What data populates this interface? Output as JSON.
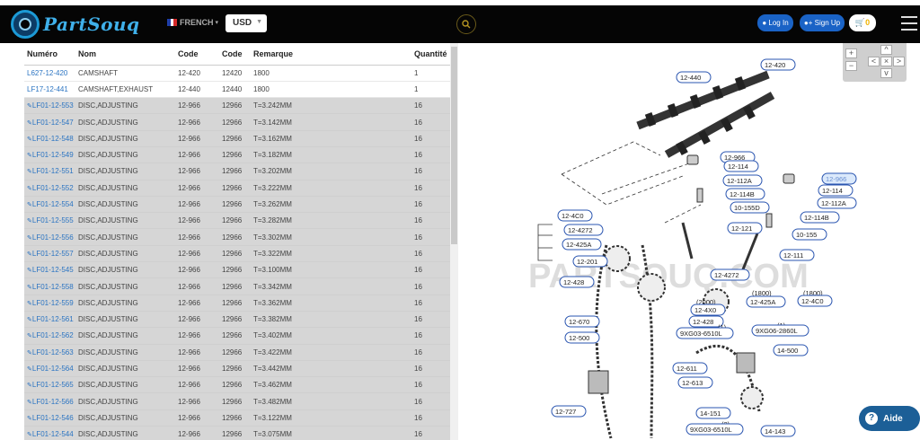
{
  "header": {
    "logo_text": "PartSouq",
    "language": "FRENCH",
    "currency": "USD",
    "login_label": "Log In",
    "signup_label": "Sign Up",
    "cart_count": "0"
  },
  "table": {
    "columns": [
      "Numéro",
      "Nom",
      "Code",
      "Code",
      "Remarque",
      "Quantité"
    ],
    "rows": [
      {
        "num": "L627-12-420",
        "name": "CAMSHAFT",
        "code1": "12-420",
        "code2": "12420",
        "remark": "1800",
        "qty": "1",
        "grey": false
      },
      {
        "num": "LF17-12-441",
        "name": "CAMSHAFT,EXHAUST",
        "code1": "12-440",
        "code2": "12440",
        "remark": "1800",
        "qty": "1",
        "grey": false
      },
      {
        "num": "LF01-12-553",
        "name": "DISC,ADJUSTING",
        "code1": "12-966",
        "code2": "12966",
        "remark": "T=3.242MM",
        "qty": "16",
        "grey": true
      },
      {
        "num": "LF01-12-547",
        "name": "DISC,ADJUSTING",
        "code1": "12-966",
        "code2": "12966",
        "remark": "T=3.142MM",
        "qty": "16",
        "grey": true
      },
      {
        "num": "LF01-12-548",
        "name": "DISC,ADJUSTING",
        "code1": "12-966",
        "code2": "12966",
        "remark": "T=3.162MM",
        "qty": "16",
        "grey": true
      },
      {
        "num": "LF01-12-549",
        "name": "DISC,ADJUSTING",
        "code1": "12-966",
        "code2": "12966",
        "remark": "T=3.182MM",
        "qty": "16",
        "grey": true
      },
      {
        "num": "LF01-12-551",
        "name": "DISC,ADJUSTING",
        "code1": "12-966",
        "code2": "12966",
        "remark": "T=3.202MM",
        "qty": "16",
        "grey": true
      },
      {
        "num": "LF01-12-552",
        "name": "DISC,ADJUSTING",
        "code1": "12-966",
        "code2": "12966",
        "remark": "T=3.222MM",
        "qty": "16",
        "grey": true
      },
      {
        "num": "LF01-12-554",
        "name": "DISC,ADJUSTING",
        "code1": "12-966",
        "code2": "12966",
        "remark": "T=3.262MM",
        "qty": "16",
        "grey": true
      },
      {
        "num": "LF01-12-555",
        "name": "DISC,ADJUSTING",
        "code1": "12-966",
        "code2": "12966",
        "remark": "T=3.282MM",
        "qty": "16",
        "grey": true
      },
      {
        "num": "LF01-12-556",
        "name": "DISC,ADJUSTING",
        "code1": "12-966",
        "code2": "12966",
        "remark": "T=3.302MM",
        "qty": "16",
        "grey": true
      },
      {
        "num": "LF01-12-557",
        "name": "DISC,ADJUSTING",
        "code1": "12-966",
        "code2": "12966",
        "remark": "T=3.322MM",
        "qty": "16",
        "grey": true
      },
      {
        "num": "LF01-12-545",
        "name": "DISC,ADJUSTING",
        "code1": "12-966",
        "code2": "12966",
        "remark": "T=3.100MM",
        "qty": "16",
        "grey": true
      },
      {
        "num": "LF01-12-558",
        "name": "DISC,ADJUSTING",
        "code1": "12-966",
        "code2": "12966",
        "remark": "T=3.342MM",
        "qty": "16",
        "grey": true
      },
      {
        "num": "LF01-12-559",
        "name": "DISC,ADJUSTING",
        "code1": "12-966",
        "code2": "12966",
        "remark": "T=3.362MM",
        "qty": "16",
        "grey": true
      },
      {
        "num": "LF01-12-561",
        "name": "DISC,ADJUSTING",
        "code1": "12-966",
        "code2": "12966",
        "remark": "T=3.382MM",
        "qty": "16",
        "grey": true
      },
      {
        "num": "LF01-12-562",
        "name": "DISC,ADJUSTING",
        "code1": "12-966",
        "code2": "12966",
        "remark": "T=3.402MM",
        "qty": "16",
        "grey": true
      },
      {
        "num": "LF01-12-563",
        "name": "DISC,ADJUSTING",
        "code1": "12-966",
        "code2": "12966",
        "remark": "T=3.422MM",
        "qty": "16",
        "grey": true
      },
      {
        "num": "LF01-12-564",
        "name": "DISC,ADJUSTING",
        "code1": "12-966",
        "code2": "12966",
        "remark": "T=3.442MM",
        "qty": "16",
        "grey": true
      },
      {
        "num": "LF01-12-565",
        "name": "DISC,ADJUSTING",
        "code1": "12-966",
        "code2": "12966",
        "remark": "T=3.462MM",
        "qty": "16",
        "grey": true
      },
      {
        "num": "LF01-12-566",
        "name": "DISC,ADJUSTING",
        "code1": "12-966",
        "code2": "12966",
        "remark": "T=3.482MM",
        "qty": "16",
        "grey": true
      },
      {
        "num": "LF01-12-546",
        "name": "DISC,ADJUSTING",
        "code1": "12-966",
        "code2": "12966",
        "remark": "T=3.122MM",
        "qty": "16",
        "grey": true
      },
      {
        "num": "LF01-12-544",
        "name": "DISC,ADJUSTING",
        "code1": "12-966",
        "code2": "12966",
        "remark": "T=3.075MM",
        "qty": "16",
        "grey": true
      }
    ]
  },
  "diagram": {
    "watermark": "PARTSOUQ.COM",
    "labels": [
      "12-440",
      "12-420",
      "12-966",
      "12-114",
      "12-112A",
      "12-114B",
      "10-155D",
      "12-966",
      "12-114",
      "12-112A",
      "12-114B",
      "10-155",
      "12-121",
      "12-111",
      "12-4C0",
      "12-4272",
      "12-425A",
      "12-201",
      "12-428",
      "12-4272",
      "(1800)",
      "12-425A",
      "(1800)",
      "12-4C0",
      "(2000)",
      "12-4X0",
      "12-428",
      "12-670",
      "12-500",
      "(1)",
      "9XG03-6510L",
      "(1)",
      "9XG06-2860L",
      "14-500",
      "12-611",
      "12-613",
      "12-727",
      "14-151",
      "(2)",
      "9XG03-6510L",
      "14-143"
    ]
  },
  "zoom": {
    "plus": "+",
    "minus": "−",
    "up": "^",
    "left": "<",
    "reset": "×",
    "right": ">",
    "down": "v"
  },
  "help": {
    "label": "Aide",
    "icon": "?"
  },
  "icons": {
    "search": "search-icon",
    "user": "user-icon",
    "user-plus": "user-plus-icon",
    "cart": "cart-icon",
    "menu": "hamburger-icon",
    "wrench": "wrench-icon"
  }
}
